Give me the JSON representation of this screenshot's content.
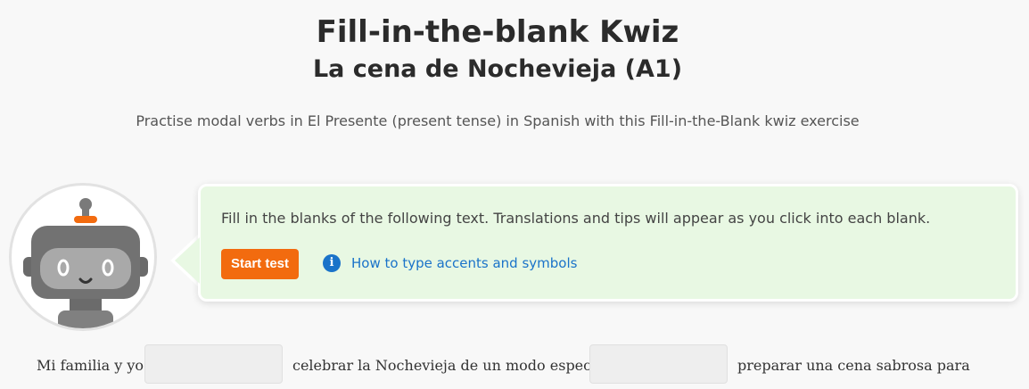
{
  "header": {
    "title": "Fill-in-the-blank Kwiz",
    "subtitle": "La cena de Nochevieja (A1)",
    "description": "Practise modal verbs in El Presente (present tense) in Spanish with this Fill-in-the-Blank kwiz exercise"
  },
  "instructions": {
    "text": "Fill in the blanks of the following text. Translations and tips will appear as you click into each blank.",
    "start_label": "Start test",
    "help_icon_glyph": "i",
    "help_label": "How to type accents and symbols"
  },
  "exercise": {
    "segments": [
      "Mi familia y yo",
      "celebrar la Nochevieja de un modo especial.",
      "preparar una cena sabrosa para"
    ],
    "blanks": [
      "",
      ""
    ]
  },
  "colors": {
    "accent_orange": "#f26b0f",
    "link_blue": "#1a73c9",
    "instructions_bg": "#e8f8e3"
  },
  "icons": {
    "avatar": "robot-avatar-icon",
    "info": "info-icon"
  }
}
